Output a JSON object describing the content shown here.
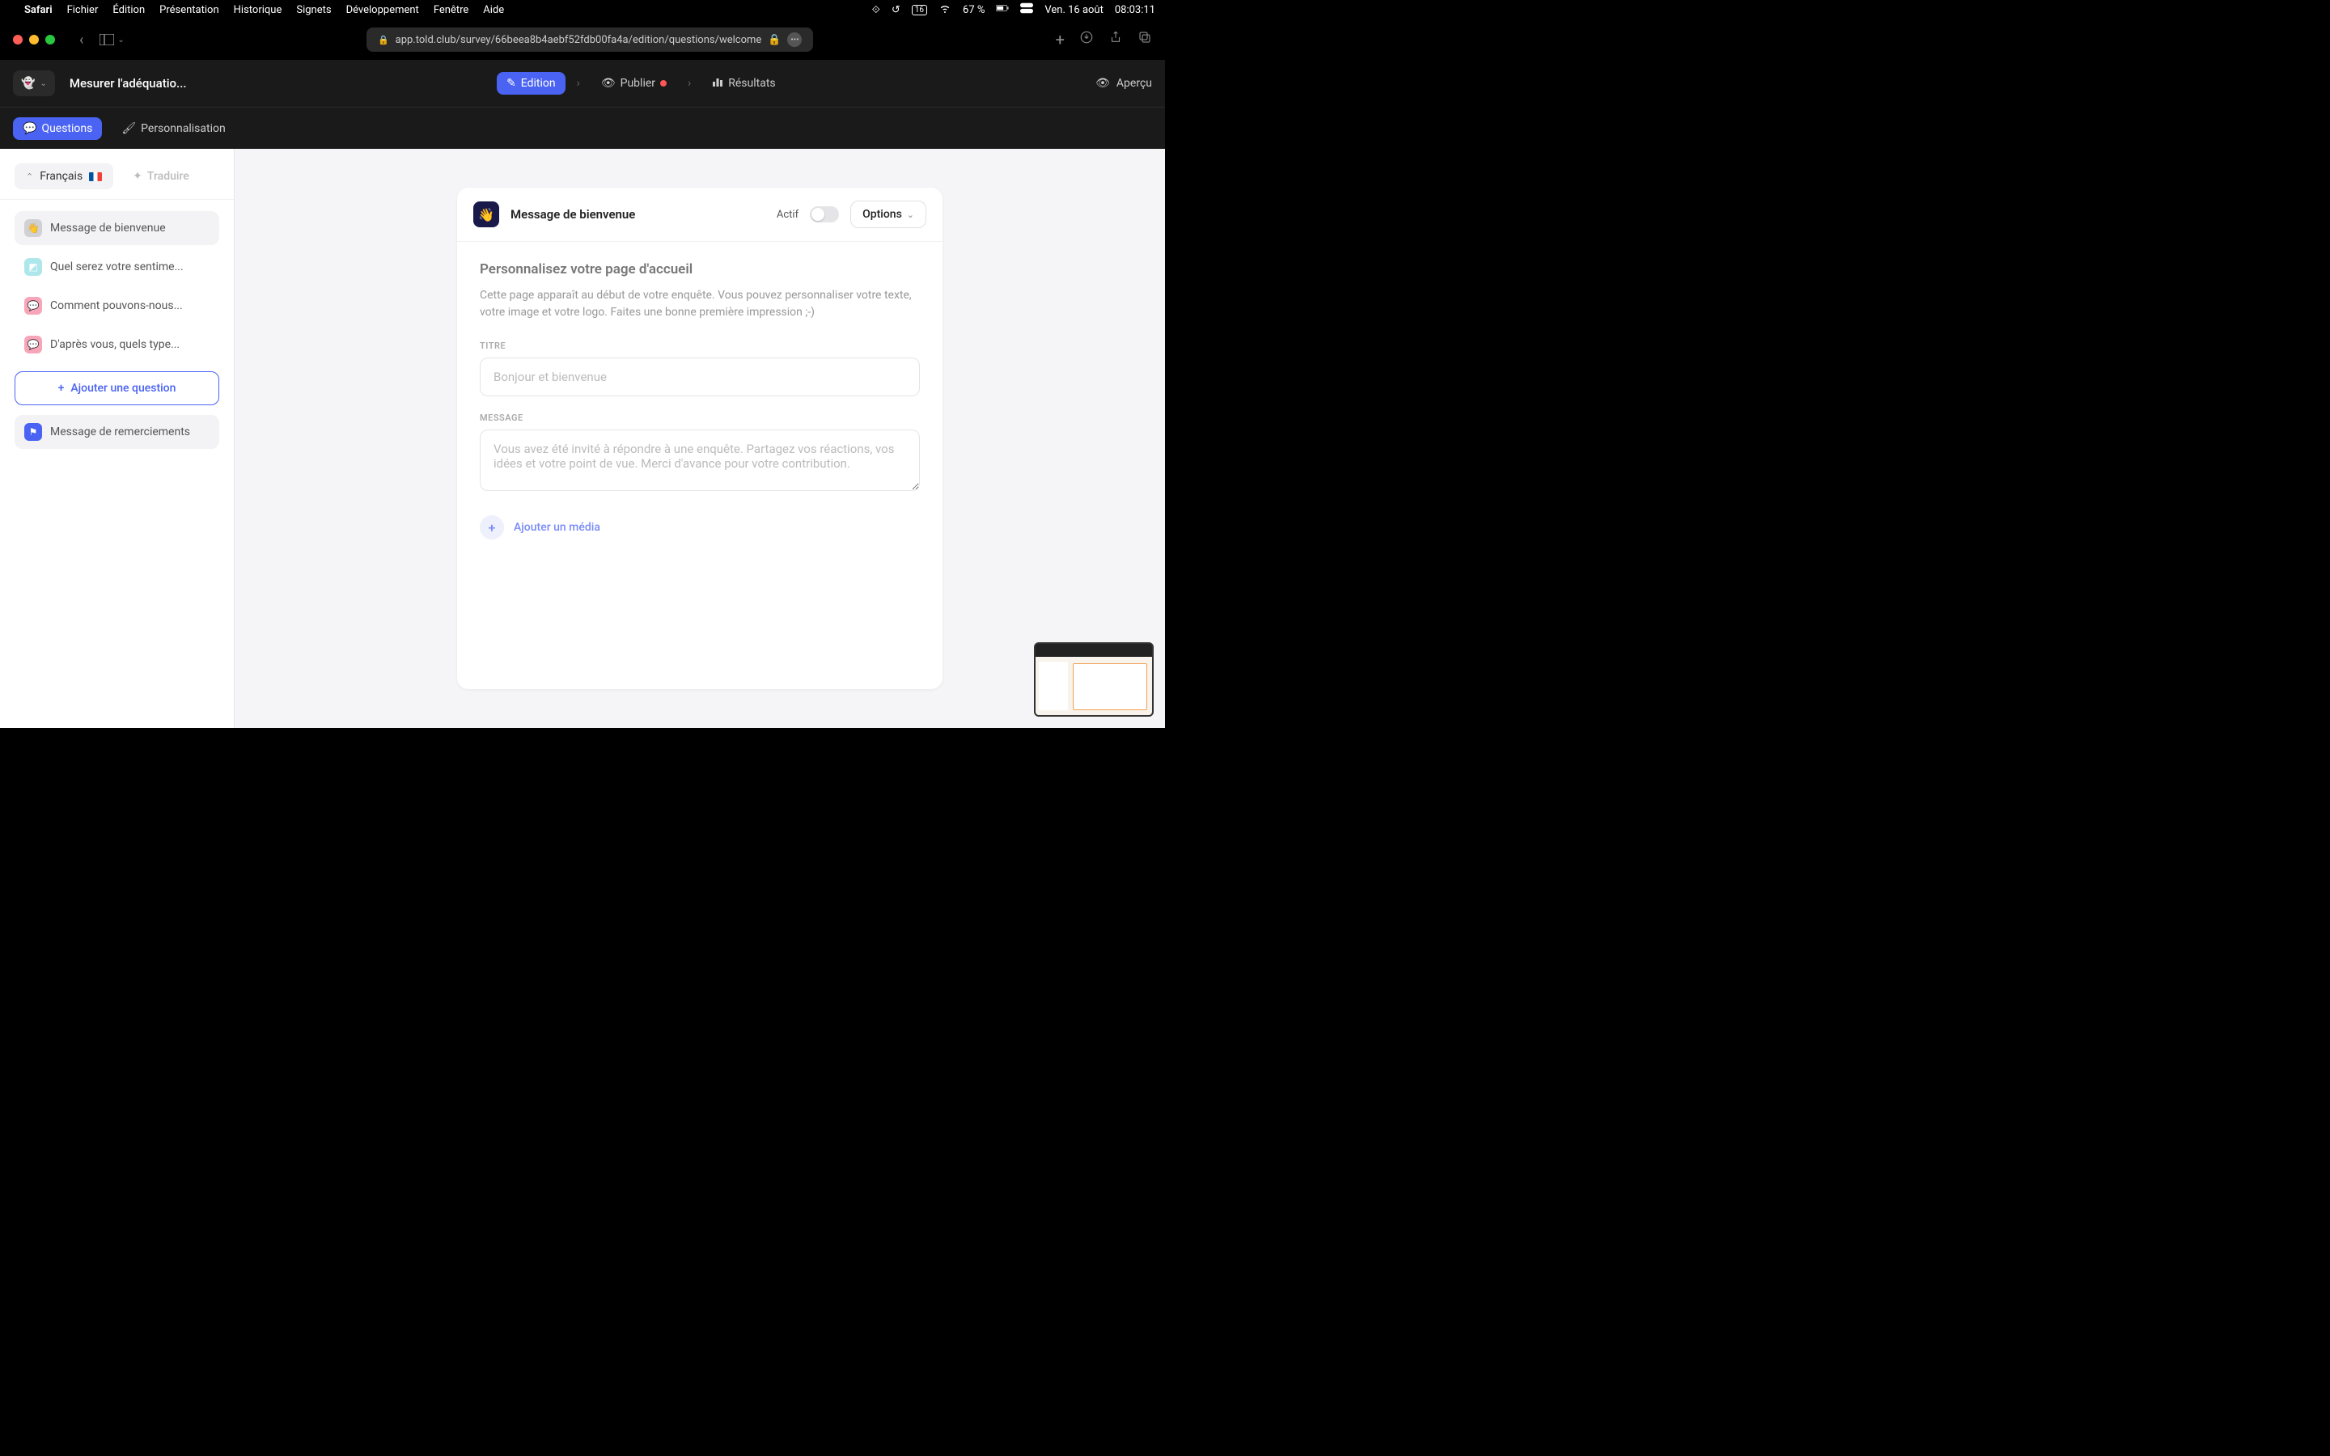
{
  "menubar": {
    "app": "Safari",
    "items": [
      "Fichier",
      "Édition",
      "Présentation",
      "Historique",
      "Signets",
      "Développement",
      "Fenêtre",
      "Aide"
    ],
    "battery": "67 %",
    "date": "Ven. 16 août",
    "time": "08:03:11",
    "calendar_day": "16"
  },
  "browser": {
    "url": "app.told.club/survey/66beea8b4aebf52fdb00fa4a/edition/questions/welcome"
  },
  "header": {
    "survey_title": "Mesurer l'adéquatio...",
    "steps": {
      "edition": "Edition",
      "publish": "Publier",
      "results": "Résultats"
    },
    "preview": "Aperçu"
  },
  "subnav": {
    "questions": "Questions",
    "personalization": "Personnalisation"
  },
  "sidebar": {
    "language": "Français",
    "translate": "Traduire",
    "items": [
      {
        "label": "Message de bienvenue",
        "icon": "grey",
        "glyph": "👋"
      },
      {
        "label": "Quel serez votre sentime...",
        "icon": "teal",
        "glyph": "◩"
      },
      {
        "label": "Comment pouvons-nous...",
        "icon": "pink",
        "glyph": "💬"
      },
      {
        "label": "D'après vous, quels type...",
        "icon": "pink",
        "glyph": "💬"
      }
    ],
    "add_question": "Ajouter une question",
    "thanks": "Message de remerciements"
  },
  "card": {
    "title": "Message de bienvenue",
    "actif": "Actif",
    "options": "Options",
    "section_title": "Personnalisez votre page d'accueil",
    "section_desc": "Cette page apparaît au début de votre enquête. Vous pouvez personnaliser votre texte, votre image et votre logo. Faites une bonne première impression ;-)",
    "title_label": "TITRE",
    "title_placeholder": "Bonjour et bienvenue",
    "message_label": "MESSAGE",
    "message_placeholder": "Vous avez été invité à répondre à une enquête. Partagez vos réactions, vos idées et votre point de vue. Merci d'avance pour votre contribution.",
    "add_media": "Ajouter un média"
  }
}
